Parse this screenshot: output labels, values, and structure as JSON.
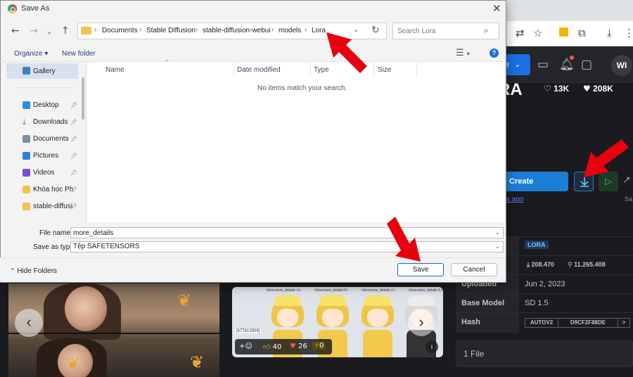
{
  "colors": {
    "arrow": "#e8000f",
    "accent_blue": "#1c7ed6",
    "dialog_bg": "#f3f3f3"
  },
  "background_page": {
    "header": {
      "avatar_initials": "WI",
      "create_mini_label": "e"
    },
    "model_title": "RA",
    "stats": {
      "likes": "13K",
      "favorites": "208K"
    },
    "create_button": "Create",
    "updated_ago": "nths ago",
    "cut_label": "Sa",
    "details": [
      {
        "key": "",
        "value": "LORA"
      },
      {
        "key": "",
        "value": "208.470",
        "value2": "11.265.408"
      },
      {
        "key": "Uploaded",
        "value": "Jun 2, 2023"
      },
      {
        "key": "Base Model",
        "value": "SD 1.5"
      },
      {
        "key": "Hash",
        "hash_type": "AUTOV2",
        "hash_value": "D9CF2F88DE",
        "hash_more": ">"
      }
    ],
    "files_label": "1 File",
    "preview_labels": [
      "<lora:more_details:-1>",
      "<lora:more_details:0>",
      "<lora:more_details:1>",
      "<lora:more_details:1.5>"
    ],
    "hash_tag": "[b77b13509]",
    "reactions": {
      "plus": "+",
      "thumbs": "40",
      "hearts": "26",
      "bolt": "0"
    },
    "info_icon": "i"
  },
  "dialog": {
    "title": "Save As",
    "close": "✕",
    "breadcrumbs": [
      "Documents",
      "Stable Diffusion",
      "stable-diffusion-webui",
      "models",
      "Lora"
    ],
    "search_placeholder": "Search Lora",
    "organize_label": "Organize ▾",
    "new_folder_label": "New folder",
    "nav_items": [
      {
        "label": "Gallery",
        "icon": "gallery-icon",
        "pinned": false
      },
      {
        "label": "Desktop",
        "icon": "desktop-icon",
        "pinned": true
      },
      {
        "label": "Downloads",
        "icon": "downloads-icon",
        "pinned": true
      },
      {
        "label": "Documents",
        "icon": "documents-icon",
        "pinned": true
      },
      {
        "label": "Pictures",
        "icon": "pictures-icon",
        "pinned": true
      },
      {
        "label": "Videos",
        "icon": "videos-icon",
        "pinned": true
      },
      {
        "label": "Khóa học Ph",
        "icon": "folder-icon",
        "pinned": true
      },
      {
        "label": "stable-diffusi",
        "icon": "folder-icon",
        "pinned": true
      }
    ],
    "columns": [
      "Name",
      "Date modified",
      "Type",
      "Size"
    ],
    "empty_message": "No items match your search.",
    "file_name_label": "File name:",
    "file_name_value": "more_details",
    "save_type_label": "Save as type:",
    "save_type_value": "Tệp SAFETENSORS",
    "hide_folders_label": "Hide Folders",
    "save_button": "Save",
    "cancel_button": "Cancel"
  }
}
